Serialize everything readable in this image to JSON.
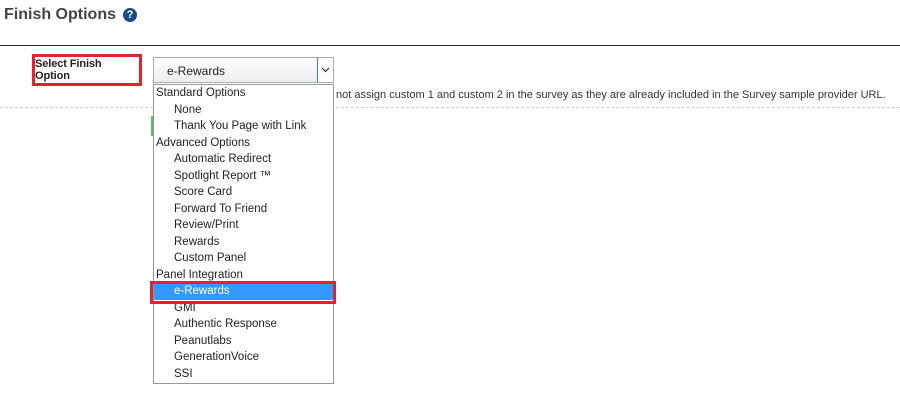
{
  "header": {
    "title": "Finish Options",
    "help_icon": "question-circle-icon"
  },
  "form": {
    "label": "Select Finish Option",
    "select_value": "e-Rewards",
    "dropdown_arrow_icon": "chevron-down-icon",
    "note": "not assign custom 1 and custom 2 in the survey as they are already included in the Survey sample provider URL."
  },
  "dropdown": {
    "options": [
      {
        "label": "Standard Options",
        "type": "group"
      },
      {
        "label": "None",
        "type": "item"
      },
      {
        "label": "Thank You Page with Link",
        "type": "item"
      },
      {
        "label": "Advanced Options",
        "type": "group"
      },
      {
        "label": "Automatic Redirect",
        "type": "item"
      },
      {
        "label": "Spotlight Report ™",
        "type": "item"
      },
      {
        "label": "Score Card",
        "type": "item"
      },
      {
        "label": "Forward To Friend",
        "type": "item"
      },
      {
        "label": "Review/Print",
        "type": "item"
      },
      {
        "label": "Rewards",
        "type": "item"
      },
      {
        "label": "Custom Panel",
        "type": "item"
      },
      {
        "label": "Panel Integration",
        "type": "group"
      },
      {
        "label": "e-Rewards",
        "type": "item",
        "selected": true
      },
      {
        "label": "GMI",
        "type": "item"
      },
      {
        "label": "Authentic Response",
        "type": "item"
      },
      {
        "label": "Peanutlabs",
        "type": "item"
      },
      {
        "label": "GenerationVoice",
        "type": "item"
      },
      {
        "label": "SSI",
        "type": "item"
      }
    ]
  },
  "colors": {
    "highlight": "#e2232d",
    "selected_bg": "#3399ff",
    "help_icon": "#1a4d8c"
  }
}
